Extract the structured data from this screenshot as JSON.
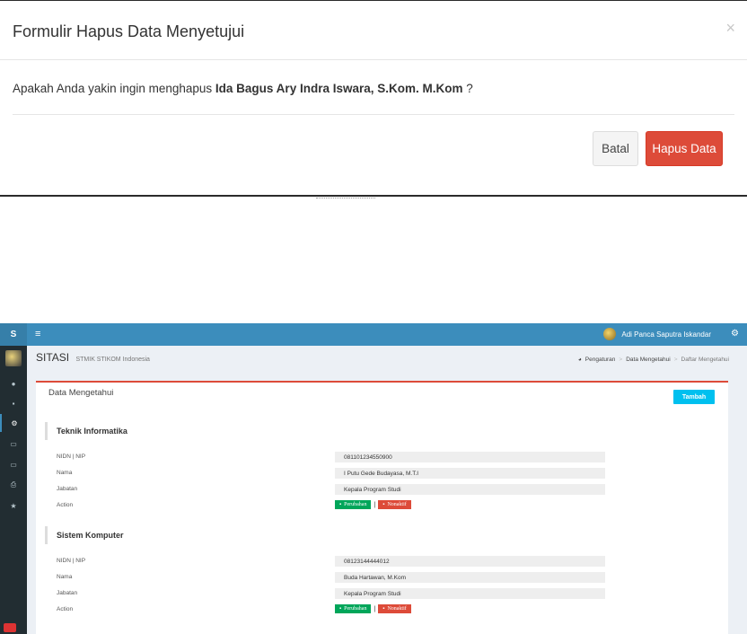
{
  "modal": {
    "title": "Formulir Hapus Data Menyetujui",
    "close": "×",
    "question_prefix": "Apakah Anda yakin ingin menghapus ",
    "target_name": "Ida Bagus Ary Indra Iswara, S.Kom. M.Kom",
    "question_suffix": " ?",
    "cancel_label": "Batal",
    "delete_label": "Hapus Data"
  },
  "app": {
    "logo": "S",
    "menu_icon": "≡",
    "user_name": "Adi Panca Saputra Iskandar",
    "settings_icon": "⚙",
    "brand": "SITASI",
    "brand_sub": "STMIK STIKOM Indonesia",
    "breadcrumb": [
      "Pengaturan",
      "Data Mengetahui",
      "Daftar Mengetahui"
    ],
    "breadcrumb_sep": ">",
    "sidebar_icons": [
      "globe-icon",
      "database-icon",
      "gears-icon",
      "desktop-icon",
      "monitor-icon",
      "print-icon",
      "star-icon"
    ]
  },
  "box": {
    "title": "Data Mengetahui",
    "add_label": "Tambah"
  },
  "fields": {
    "nidn": "NIDN | NIP",
    "nama": "Nama",
    "jabatan": "Jabatan",
    "action": "Action"
  },
  "actions": {
    "edit_label": "Perubahan",
    "deactivate_label": "Nonaktif",
    "sep": "|"
  },
  "sections": [
    {
      "title": "Teknik Informatika",
      "nidn": "081101234550900",
      "nama": "I Putu Gede Budayasa, M.T.I",
      "jabatan": "Kepala Program Studi"
    },
    {
      "title": "Sistem Komputer",
      "nidn": "08123144444012",
      "nama": "Buda Hartawan, M.Kom",
      "jabatan": "Kepala Program Studi"
    }
  ],
  "colors": {
    "primary": "#3c8dbc",
    "danger": "#dd4b39",
    "success": "#00a65a",
    "info": "#00c0ef"
  }
}
